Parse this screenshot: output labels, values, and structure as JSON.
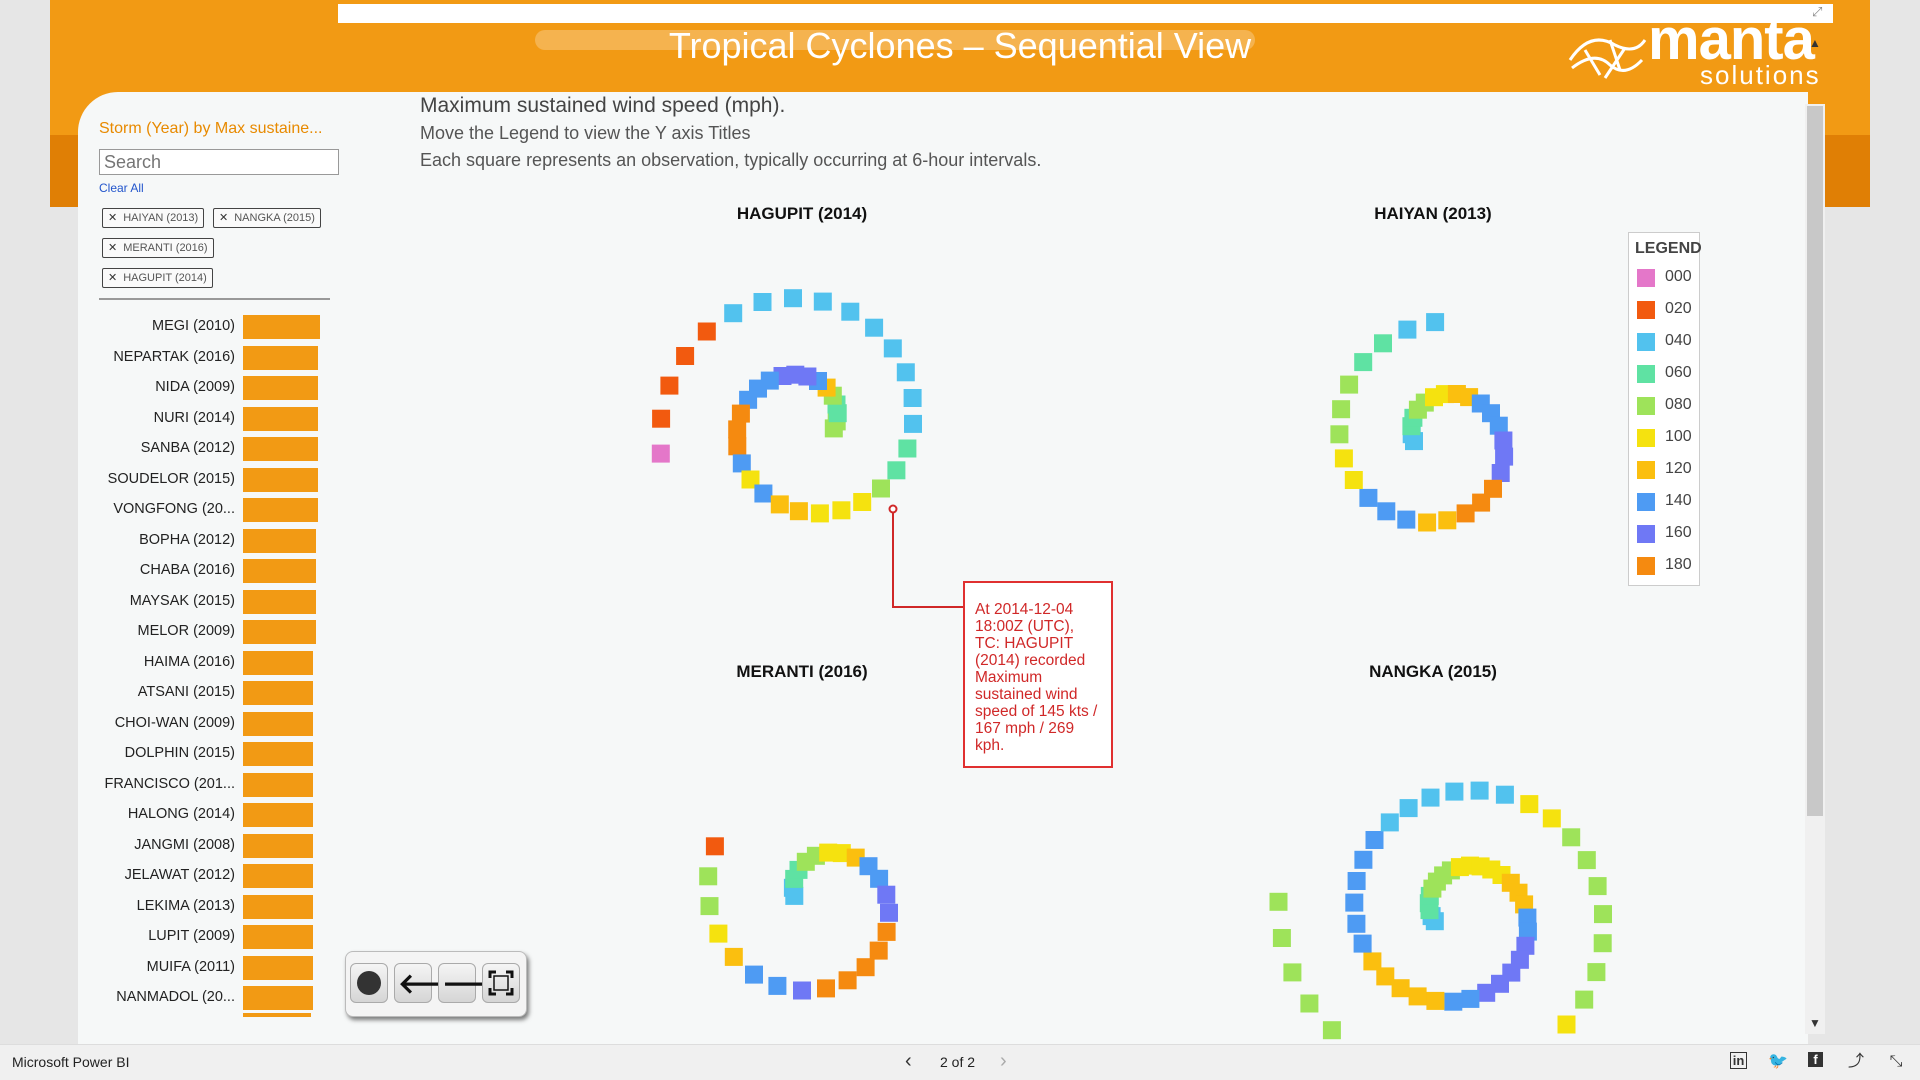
{
  "report": {
    "title": "Tropical Cyclones – Sequential View",
    "logo_main": "manta",
    "logo_sub": "solutions",
    "brand_orange": "#f29a14"
  },
  "intro": {
    "line1": "Maximum sustained wind speed (mph).",
    "line2": "Move the Legend to view the Y axis Titles",
    "line3": "Each square represents an observation, typically occurring at 6-hour intervals."
  },
  "slicer": {
    "title": "Storm (Year) by Max sustaine...",
    "search_placeholder": "Search",
    "clear_all": "Clear All",
    "selected": [
      "HAIYAN (2013)",
      "NANGKA (2015)",
      "MERANTI (2016)",
      "HAGUPIT (2014)"
    ],
    "bar_color": "#f29a14",
    "items": [
      {
        "label": "MEGI (2010)",
        "value": 1.0
      },
      {
        "label": "NEPARTAK (2016)",
        "value": 0.98
      },
      {
        "label": "NIDA (2009)",
        "value": 0.98
      },
      {
        "label": "NURI (2014)",
        "value": 0.98
      },
      {
        "label": "SANBA (2012)",
        "value": 0.98
      },
      {
        "label": "SOUDELOR (2015)",
        "value": 0.98
      },
      {
        "label": "VONGFONG (20...",
        "value": 0.98
      },
      {
        "label": "BOPHA (2012)",
        "value": 0.95
      },
      {
        "label": "CHABA (2016)",
        "value": 0.95
      },
      {
        "label": "MAYSAK (2015)",
        "value": 0.95
      },
      {
        "label": "MELOR (2009)",
        "value": 0.95
      },
      {
        "label": "HAIMA (2016)",
        "value": 0.91
      },
      {
        "label": "ATSANI (2015)",
        "value": 0.91
      },
      {
        "label": "CHOI-WAN (2009)",
        "value": 0.91
      },
      {
        "label": "DOLPHIN (2015)",
        "value": 0.91
      },
      {
        "label": "FRANCISCO (201...",
        "value": 0.91
      },
      {
        "label": "HALONG (2014)",
        "value": 0.91
      },
      {
        "label": "JANGMI (2008)",
        "value": 0.91
      },
      {
        "label": "JELAWAT (2012)",
        "value": 0.91
      },
      {
        "label": "LEKIMA (2013)",
        "value": 0.91
      },
      {
        "label": "LUPIT (2009)",
        "value": 0.91
      },
      {
        "label": "MUIFA (2011)",
        "value": 0.91
      },
      {
        "label": "NANMADOL (20...",
        "value": 0.91
      }
    ]
  },
  "charts": {
    "hagupit_title": "HAGUPIT (2014)",
    "haiyan_title": "HAIYAN (2013)",
    "meranti_title": "MERANTI (2016)",
    "nangka_title": "NANGKA (2015)"
  },
  "chart_data": {
    "type": "scatter",
    "color_scale": [
      {
        "label": "000",
        "color": "#e477c9"
      },
      {
        "label": "020",
        "color": "#f25a0f"
      },
      {
        "label": "040",
        "color": "#52c2ee"
      },
      {
        "label": "060",
        "color": "#5fe2a3"
      },
      {
        "label": "080",
        "color": "#9ee35a"
      },
      {
        "label": "100",
        "color": "#f5e20f"
      },
      {
        "label": "120",
        "color": "#fbbf0f"
      },
      {
        "label": "140",
        "color": "#4e9bf3"
      },
      {
        "label": "160",
        "color": "#6f78f5"
      },
      {
        "label": "180",
        "color": "#f58a10"
      }
    ],
    "series": [
      {
        "name": "HAGUPIT (2014)",
        "wind_classes": [
          4,
          4,
          3,
          3,
          4,
          6,
          7,
          8,
          8,
          8,
          7,
          7,
          7,
          9,
          9,
          9,
          7,
          5,
          7,
          6,
          6,
          5,
          5,
          5,
          4,
          3,
          3,
          2,
          2,
          2,
          2,
          2,
          2,
          2,
          2,
          2,
          2,
          1,
          1,
          1,
          1,
          0
        ]
      },
      {
        "name": "HAIYAN (2013)",
        "wind_classes": [
          2,
          2,
          3,
          3,
          4,
          4,
          5,
          5,
          6,
          6,
          7,
          7,
          7,
          8,
          8,
          8,
          9,
          9,
          9,
          6,
          6,
          7,
          7,
          7,
          5,
          5,
          4,
          4,
          4,
          3,
          3,
          2,
          2
        ]
      },
      {
        "name": "MERANTI (2016)",
        "wind_classes": [
          2,
          2,
          3,
          3,
          4,
          4,
          5,
          5,
          6,
          7,
          7,
          8,
          8,
          9,
          9,
          9,
          9,
          9,
          8,
          7,
          7,
          6,
          5,
          4,
          4,
          1
        ]
      },
      {
        "name": "NANGKA (2015)",
        "wind_classes": [
          2,
          2,
          3,
          3,
          3,
          4,
          4,
          4,
          4,
          5,
          5,
          5,
          5,
          5,
          6,
          6,
          6,
          7,
          7,
          8,
          8,
          8,
          8,
          8,
          7,
          7,
          6,
          6,
          6,
          6,
          6,
          7,
          7,
          7,
          7,
          7,
          7,
          2,
          2,
          2,
          2,
          2,
          2,
          5,
          5,
          4,
          4,
          4,
          4,
          4,
          4,
          4,
          5,
          5,
          5,
          5,
          5,
          5,
          4,
          4,
          4,
          4,
          4,
          4,
          4
        ]
      }
    ]
  },
  "tooltip": {
    "text": "At 2014-12-04 18:00Z (UTC), TC: HAGUPIT (2014) recorded Maximum sustained wind speed of 145 kts / 167 mph / 269 kph."
  },
  "legend": {
    "title": "LEGEND"
  },
  "statusbar": {
    "app_name": "Microsoft Power BI",
    "page": "2 of 2"
  }
}
